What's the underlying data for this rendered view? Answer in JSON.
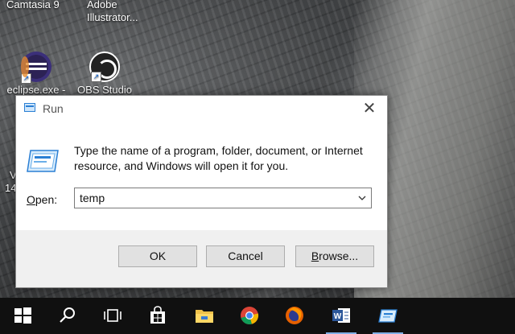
{
  "desktop": {
    "top_icons": [
      {
        "label": "Camtasia 9"
      },
      {
        "label": "Adobe Illustrator..."
      }
    ],
    "icons": [
      {
        "label": "eclipse.exe -",
        "icon": "eclipse-icon"
      },
      {
        "label": "OBS Studio",
        "icon": "obs-icon"
      }
    ],
    "partial_labels": [
      "V",
      "14"
    ]
  },
  "dialog": {
    "title": "Run",
    "close_glyph": "✕",
    "description": "Type the name of a program, folder, document, or Internet resource, and Windows will open it for you.",
    "open_label_accel": "O",
    "open_label_rest": "pen:",
    "input_value": "temp",
    "buttons": {
      "ok": "OK",
      "cancel": "Cancel",
      "browse_accel": "B",
      "browse_rest": "rowse..."
    }
  },
  "taskbar": {
    "items": [
      {
        "name": "start-button",
        "icon": "windows-logo-icon"
      },
      {
        "name": "search-button",
        "icon": "search-icon"
      },
      {
        "name": "task-view-button",
        "icon": "task-view-icon"
      },
      {
        "name": "store-button",
        "icon": "store-icon"
      },
      {
        "name": "file-explorer-button",
        "icon": "folder-icon"
      },
      {
        "name": "chrome-button",
        "icon": "chrome-icon"
      },
      {
        "name": "firefox-button",
        "icon": "firefox-icon"
      },
      {
        "name": "word-button",
        "icon": "word-icon"
      },
      {
        "name": "run-button",
        "icon": "run-icon"
      }
    ]
  },
  "colors": {
    "dialog_footer": "#f0f0f0",
    "button_face": "#e1e1e1",
    "taskbar": "#101010",
    "accent": "#1e90ff"
  }
}
